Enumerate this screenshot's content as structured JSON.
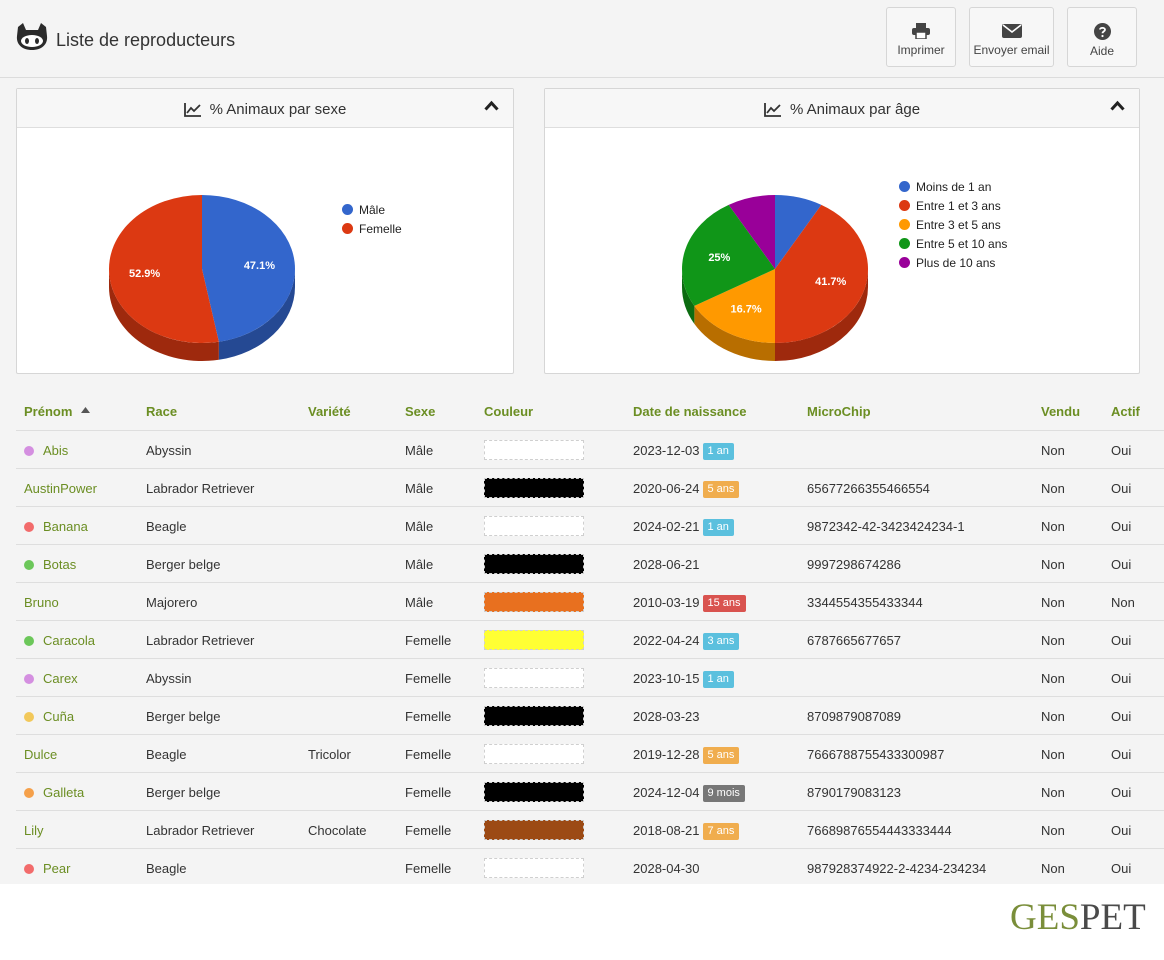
{
  "header": {
    "title": "Liste de reproducteurs",
    "buttons": [
      {
        "label": "Imprimer",
        "icon": "print-icon"
      },
      {
        "label": "Envoyer email",
        "icon": "envelope-icon"
      },
      {
        "label": "Aide",
        "icon": "question-circle-icon"
      }
    ]
  },
  "panels": {
    "sex": {
      "title": "% Animaux par sexe"
    },
    "age": {
      "title": "% Animaux par âge"
    }
  },
  "chart_data": [
    {
      "type": "pie",
      "title": "% Animaux par sexe",
      "categories": [
        "Mâle",
        "Femelle"
      ],
      "values": [
        47.1,
        52.9
      ],
      "labels": [
        "47.1%",
        "52.9%"
      ],
      "colors": [
        "#3366cc",
        "#dc3912"
      ],
      "legend_position": "right"
    },
    {
      "type": "pie",
      "title": "% Animaux par âge",
      "categories": [
        "Moins de 1 an",
        "Entre 1 et 3 ans",
        "Entre 3 et 5 ans",
        "Entre 5 et 10 ans",
        "Plus de 10 ans"
      ],
      "values": [
        8.3,
        41.7,
        16.7,
        25,
        8.3
      ],
      "labels": [
        "",
        "41.7%",
        "16.7%",
        "25%",
        ""
      ],
      "colors": [
        "#3366cc",
        "#dc3912",
        "#ff9900",
        "#109618",
        "#990099"
      ],
      "legend_position": "right"
    }
  ],
  "table": {
    "columns": [
      "Prénom",
      "Race",
      "Variété",
      "Sexe",
      "Couleur",
      "Date de naissance",
      "MicroChip",
      "Vendu",
      "Actif"
    ],
    "sort_column": "Prénom",
    "rows": [
      {
        "dot": "#d48fe0",
        "name": "Abis",
        "race": "Abyssin",
        "variete": "",
        "sexe": "Mâle",
        "couleur": "#ffffff",
        "date": "2023-12-03",
        "age": "1 an",
        "age_color": "#5bc0de",
        "chip": "",
        "vendu": "Non",
        "actif": "Oui"
      },
      {
        "dot": "",
        "name": "AustinPower",
        "race": "Labrador Retriever",
        "variete": "",
        "sexe": "Mâle",
        "couleur": "#000000",
        "date": "2020-06-24",
        "age": "5 ans",
        "age_color": "#f0ad4e",
        "chip": "65677266355466554",
        "vendu": "Non",
        "actif": "Oui"
      },
      {
        "dot": "#f26b6b",
        "name": "Banana",
        "race": "Beagle",
        "variete": "",
        "sexe": "Mâle",
        "couleur": "#ffffff",
        "date": "2024-02-21",
        "age": "1 an",
        "age_color": "#5bc0de",
        "chip": "9872342-42-3423424234-1",
        "vendu": "Non",
        "actif": "Oui"
      },
      {
        "dot": "#6cc75a",
        "name": "Botas",
        "race": "Berger belge",
        "variete": "",
        "sexe": "Mâle",
        "couleur": "#000000",
        "date": "2028-06-21",
        "age": "",
        "age_color": "",
        "chip": "9997298674286",
        "vendu": "Non",
        "actif": "Oui"
      },
      {
        "dot": "",
        "name": "Bruno",
        "race": "Majorero",
        "variete": "",
        "sexe": "Mâle",
        "couleur": "#e8701f",
        "date": "2010-03-19",
        "age": "15 ans",
        "age_color": "#d9534f",
        "chip": "3344554355433344",
        "vendu": "Non",
        "actif": "Non"
      },
      {
        "dot": "#6cc75a",
        "name": "Caracola",
        "race": "Labrador Retriever",
        "variete": "",
        "sexe": "Femelle",
        "couleur": "#ffff33",
        "date": "2022-04-24",
        "age": "3 ans",
        "age_color": "#5bc0de",
        "chip": "6787665677657",
        "vendu": "Non",
        "actif": "Oui"
      },
      {
        "dot": "#d48fe0",
        "name": "Carex",
        "race": "Abyssin",
        "variete": "",
        "sexe": "Femelle",
        "couleur": "#ffffff",
        "date": "2023-10-15",
        "age": "1 an",
        "age_color": "#5bc0de",
        "chip": "",
        "vendu": "Non",
        "actif": "Oui"
      },
      {
        "dot": "#f2c85a",
        "name": "Cuña",
        "race": "Berger belge",
        "variete": "",
        "sexe": "Femelle",
        "couleur": "#000000",
        "date": "2028-03-23",
        "age": "",
        "age_color": "",
        "chip": "8709879087089",
        "vendu": "Non",
        "actif": "Oui"
      },
      {
        "dot": "",
        "name": "Dulce",
        "race": "Beagle",
        "variete": "Tricolor",
        "sexe": "Femelle",
        "couleur": "#ffffff",
        "date": "2019-12-28",
        "age": "5 ans",
        "age_color": "#f0ad4e",
        "chip": "7666788755433300987",
        "vendu": "Non",
        "actif": "Oui"
      },
      {
        "dot": "#f5a04a",
        "name": "Galleta",
        "race": "Berger belge",
        "variete": "",
        "sexe": "Femelle",
        "couleur": "#000000",
        "date": "2024-12-04",
        "age": "9 mois",
        "age_color": "#777777",
        "chip": "8790179083123",
        "vendu": "Non",
        "actif": "Oui"
      },
      {
        "dot": "",
        "name": "Lily",
        "race": "Labrador Retriever",
        "variete": "Chocolate",
        "sexe": "Femelle",
        "couleur": "#9c4a14",
        "date": "2018-08-21",
        "age": "7 ans",
        "age_color": "#f0ad4e",
        "chip": "76689876554443333444",
        "vendu": "Non",
        "actif": "Oui"
      },
      {
        "dot": "#f26b6b",
        "name": "Pear",
        "race": "Beagle",
        "variete": "",
        "sexe": "Femelle",
        "couleur": "#ffffff",
        "date": "2028-04-30",
        "age": "",
        "age_color": "",
        "chip": "987928374922-2-4234-234234",
        "vendu": "Non",
        "actif": "Oui"
      }
    ]
  },
  "brand": {
    "part1": "GES",
    "part2": "PET"
  }
}
